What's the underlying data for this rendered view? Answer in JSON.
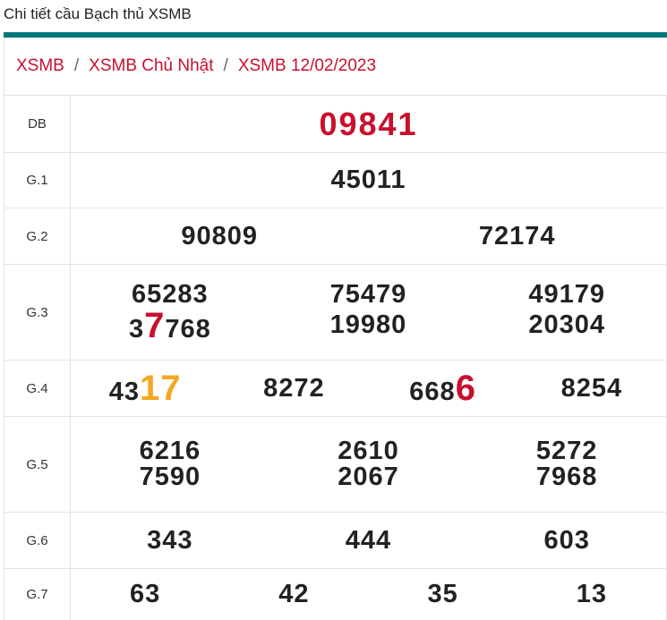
{
  "header": {
    "title": "Chi tiết cầu Bạch thủ XSMB"
  },
  "colors": {
    "accent": "#00787a",
    "link": "#c8102e",
    "highlight_red": "#c8102e",
    "highlight_orange": "#f5a623"
  },
  "breadcrumb": {
    "items": [
      "XSMB",
      "XSMB Chủ Nhật",
      "XSMB 12/02/2023"
    ],
    "separator": "/"
  },
  "results": {
    "db": {
      "label": "DB",
      "numbers": [
        "09841"
      ]
    },
    "g1": {
      "label": "G.1",
      "numbers": [
        "45011"
      ]
    },
    "g2": {
      "label": "G.2",
      "numbers": [
        "90809",
        "72174"
      ]
    },
    "g3": {
      "label": "G.3",
      "numbers": [
        "65283",
        "75479",
        "49179",
        "7768",
        "19980",
        "20304"
      ],
      "first_row4_prefix": "3",
      "first_row4_highlight": "7",
      "first_row4_rest": "768"
    },
    "g4": {
      "label": "G.4",
      "n1_prefix": "43",
      "n1_highlight": "17",
      "n2": "8272",
      "n3_prefix": "668",
      "n3_highlight": "6",
      "n4": "8254"
    },
    "g5": {
      "label": "G.5",
      "numbers": [
        "6216",
        "2610",
        "5272",
        "7590",
        "2067",
        "7968"
      ]
    },
    "g6": {
      "label": "G.6",
      "numbers": [
        "343",
        "444",
        "603"
      ]
    },
    "g7": {
      "label": "G.7",
      "numbers": [
        "63",
        "42",
        "35",
        "13"
      ]
    }
  }
}
